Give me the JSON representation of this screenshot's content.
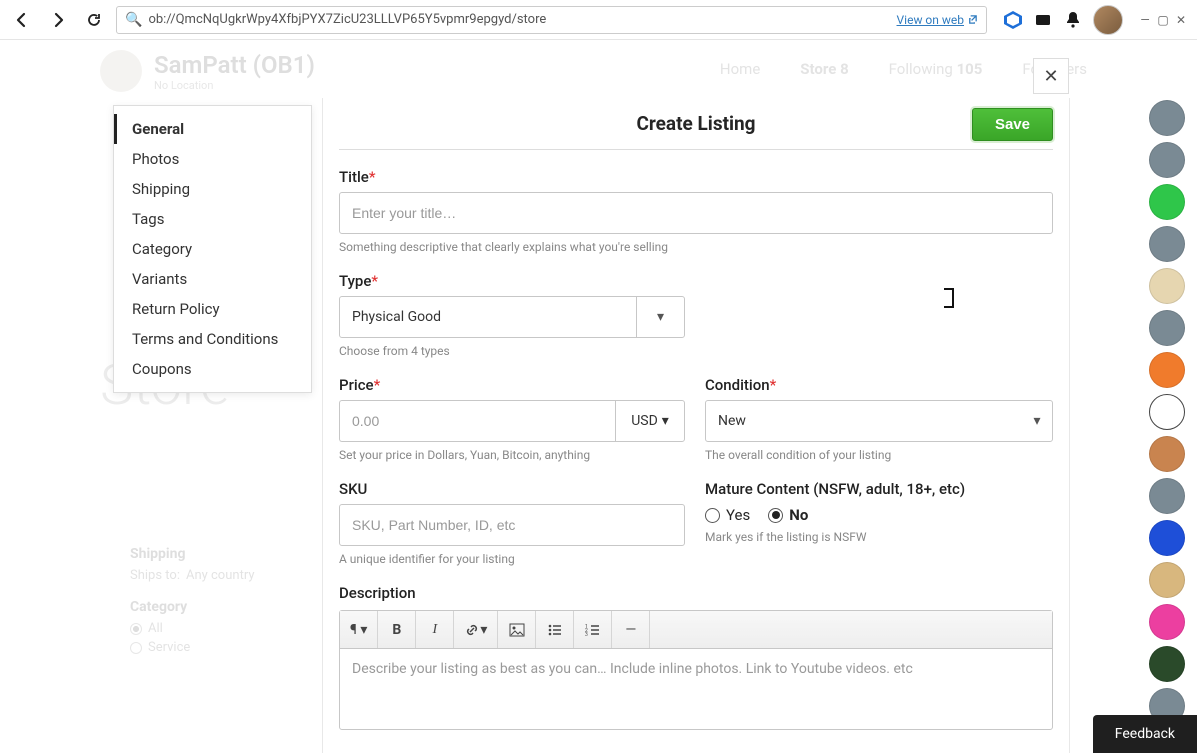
{
  "toolbar": {
    "address": "ob://QmcNqUgkrWpy4XfbjPYX7ZicU23LLLVP65Y5vpmr9epgyd/store",
    "view_on_web": "View on web"
  },
  "background": {
    "profile_name": "SamPatt (OB1)",
    "profile_sub_left": "No Location",
    "nav": {
      "home": "Home",
      "store": "Store",
      "store_count": "8",
      "following": "Following",
      "following_count": "105",
      "followers": "Followers"
    },
    "store_heading": "Store",
    "sidebar": {
      "shipping_header": "Shipping",
      "ships_to_label": "Ships to:",
      "ships_to_value": "Any country",
      "category_header": "Category",
      "cat_all": "All",
      "cat_service": "Service"
    }
  },
  "side_nav": {
    "items": [
      "General",
      "Photos",
      "Shipping",
      "Tags",
      "Category",
      "Variants",
      "Return Policy",
      "Terms and Conditions",
      "Coupons"
    ]
  },
  "form": {
    "header": "Create Listing",
    "save": "Save",
    "title": {
      "label": "Title",
      "placeholder": "Enter your title…",
      "hint": "Something descriptive that clearly explains what you're selling"
    },
    "type": {
      "label": "Type",
      "value": "Physical Good",
      "hint": "Choose from 4 types"
    },
    "price": {
      "label": "Price",
      "placeholder": "0.00",
      "currency": "USD",
      "hint": "Set your price in Dollars, Yuan, Bitcoin, anything"
    },
    "condition": {
      "label": "Condition",
      "value": "New",
      "hint": "The overall condition of your listing"
    },
    "sku": {
      "label": "SKU",
      "placeholder": "SKU, Part Number, ID, etc",
      "hint": "A unique identifier for your listing"
    },
    "mature": {
      "label": "Mature Content (NSFW, adult, 18+, etc)",
      "yes": "Yes",
      "no": "No",
      "hint": "Mark yes if the listing is NSFW"
    },
    "description": {
      "label": "Description",
      "placeholder": "Describe your listing as best as you can… Include inline photos. Link to Youtube videos. etc"
    }
  },
  "feedback": "Feedback",
  "rail_colors": [
    "#7a8a94",
    "#7a8a94",
    "#2fc64a",
    "#7a8a94",
    "#e6d6b0",
    "#7a8a94",
    "#f07b2c",
    "#ffffff",
    "#c9844f",
    "#7a8a94",
    "#1e4fd8",
    "#d8b77e",
    "#ec3fa0",
    "#2a4a2a",
    "#7a8a94"
  ]
}
